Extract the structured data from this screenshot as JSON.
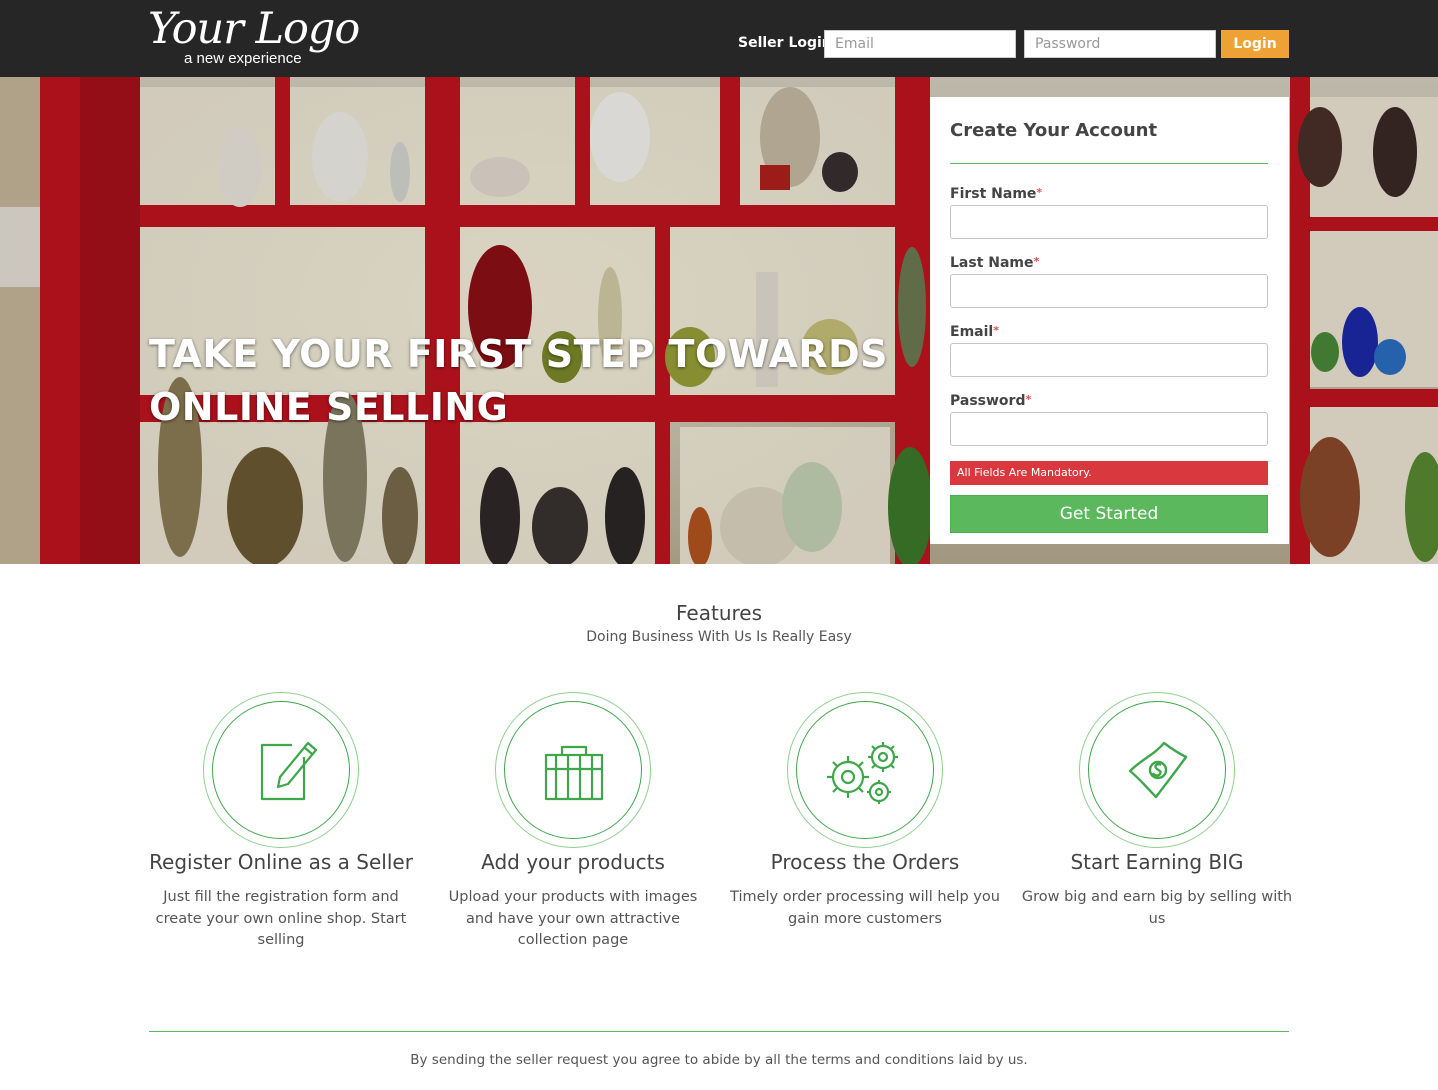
{
  "header": {
    "logo_text": "Your Logo",
    "logo_tagline": "a new experience",
    "seller_login_label": "Seller Login",
    "email_placeholder": "Email",
    "password_placeholder": "Password",
    "login_button": "Login"
  },
  "hero": {
    "title_line1": "TAKE YOUR FIRST STEP TOWARDS",
    "title_line2": "ONLINE SELLING"
  },
  "signup_form": {
    "title": "Create Your Account",
    "required_mark": "*",
    "fields": [
      {
        "label": "First Name",
        "value": ""
      },
      {
        "label": "Last Name",
        "value": ""
      },
      {
        "label": "Email",
        "value": ""
      },
      {
        "label": "Password",
        "value": ""
      }
    ],
    "alert": "All Fields Are Mandatory.",
    "submit_button": "Get Started"
  },
  "features": {
    "title": "Features",
    "subtitle": "Doing Business With Us Is Really Easy",
    "items": [
      {
        "icon": "edit-icon",
        "title": "Register Online as a Seller",
        "text": "Just fill the registration form and create your own online shop. Start selling"
      },
      {
        "icon": "briefcase-icon",
        "title": "Add your products",
        "text": "Upload your products with images and have your own attractive collection page"
      },
      {
        "icon": "gears-icon",
        "title": "Process the Orders",
        "text": "Timely order processing will help you gain more customers"
      },
      {
        "icon": "money-icon",
        "title": "Start Earning BIG",
        "text": "Grow big and earn big by selling with us"
      }
    ]
  },
  "footer": {
    "text": "By sending the seller request you agree to abide by all the terms and conditions laid by us."
  },
  "colors": {
    "accent_green": "#5cb85c",
    "login_orange": "#eea236",
    "alert_red": "#d9393e",
    "topbar": "#262626"
  }
}
